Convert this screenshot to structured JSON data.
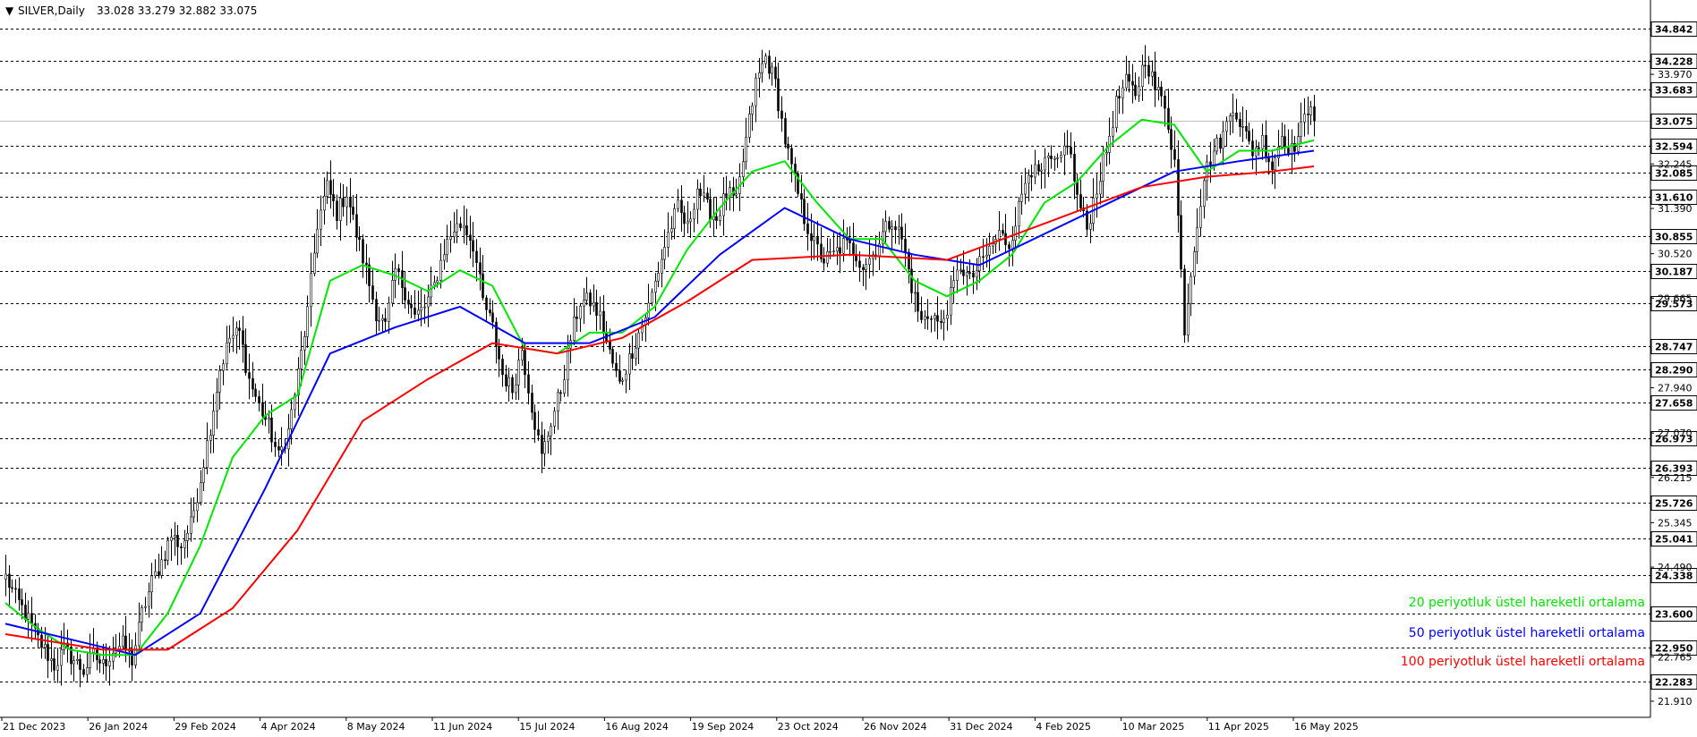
{
  "header": {
    "symbol_label": "SILVER,Daily",
    "ohlc_label": "33.028 33.279 32.882 33.075"
  },
  "legend": [
    {
      "label": "20 periyotluk üstel hareketli ortalama",
      "color": "#00e600"
    },
    {
      "label": "50 periyotluk üstel hareketli ortalama",
      "color": "#0000ff"
    },
    {
      "label": "100 periyotluk üstel hareketli ortalama",
      "color": "#ff0000"
    }
  ],
  "chart_data": {
    "type": "candlestick",
    "x_labels": [
      "21 Dec 2023",
      "26 Jan 2024",
      "29 Feb 2024",
      "4 Apr 2024",
      "8 May 2024",
      "11 Jun 2024",
      "15 Jul 2024",
      "16 Aug 2024",
      "19 Sep 2024",
      "23 Oct 2024",
      "26 Nov 2024",
      "31 Dec 2024",
      "4 Feb 2025",
      "10 Mar 2025",
      "11 Apr 2025",
      "16 May 2025"
    ],
    "ylim": [
      21.6,
      35.4
    ],
    "level_lines": [
      34.842,
      34.228,
      33.683,
      32.594,
      32.085,
      31.61,
      30.855,
      30.187,
      29.573,
      28.747,
      28.29,
      27.658,
      26.973,
      26.393,
      25.726,
      25.041,
      24.338,
      23.6,
      22.95,
      22.283
    ],
    "current_price": 33.075,
    "y_scale_ticks": [
      33.97,
      32.245,
      31.39,
      30.52,
      29.665,
      27.94,
      27.07,
      26.215,
      25.345,
      24.49,
      22.765,
      21.91
    ],
    "price_path": [
      [
        0,
        24.3
      ],
      [
        3,
        23.9
      ],
      [
        6,
        23.6
      ],
      [
        9,
        23.2
      ],
      [
        12,
        22.9
      ],
      [
        15,
        22.6
      ],
      [
        18,
        22.9
      ],
      [
        21,
        22.7
      ],
      [
        24,
        22.5
      ],
      [
        27,
        22.8
      ],
      [
        30,
        22.6
      ],
      [
        33,
        22.9
      ],
      [
        36,
        23.0
      ],
      [
        39,
        22.7
      ],
      [
        42,
        23.6
      ],
      [
        45,
        24.2
      ],
      [
        48,
        24.6
      ],
      [
        51,
        25.1
      ],
      [
        54,
        24.9
      ],
      [
        57,
        25.3
      ],
      [
        60,
        26.2
      ],
      [
        63,
        27.2
      ],
      [
        66,
        28.3
      ],
      [
        69,
        28.9
      ],
      [
        72,
        29.0
      ],
      [
        75,
        28.1
      ],
      [
        78,
        27.6
      ],
      [
        81,
        27.2
      ],
      [
        84,
        26.6
      ],
      [
        87,
        27.1
      ],
      [
        90,
        28.2
      ],
      [
        93,
        29.4
      ],
      [
        96,
        31.1
      ],
      [
        99,
        31.8
      ],
      [
        102,
        31.3
      ],
      [
        105,
        31.7
      ],
      [
        108,
        30.9
      ],
      [
        111,
        30.2
      ],
      [
        114,
        29.4
      ],
      [
        117,
        29.1
      ],
      [
        120,
        30.2
      ],
      [
        123,
        29.8
      ],
      [
        126,
        29.3
      ],
      [
        129,
        29.5
      ],
      [
        132,
        29.9
      ],
      [
        135,
        30.6
      ],
      [
        138,
        31.0
      ],
      [
        141,
        31.1
      ],
      [
        144,
        30.7
      ],
      [
        147,
        29.6
      ],
      [
        150,
        29.1
      ],
      [
        153,
        28.2
      ],
      [
        156,
        27.9
      ],
      [
        159,
        28.7
      ],
      [
        162,
        27.6
      ],
      [
        165,
        26.6
      ],
      [
        168,
        27.3
      ],
      [
        171,
        27.9
      ],
      [
        174,
        28.9
      ],
      [
        177,
        29.6
      ],
      [
        180,
        29.6
      ],
      [
        183,
        29.3
      ],
      [
        186,
        28.6
      ],
      [
        189,
        28.0
      ],
      [
        192,
        28.5
      ],
      [
        195,
        29.0
      ],
      [
        198,
        29.5
      ],
      [
        201,
        30.2
      ],
      [
        204,
        30.9
      ],
      [
        207,
        31.4
      ],
      [
        210,
        31.0
      ],
      [
        213,
        31.8
      ],
      [
        216,
        31.4
      ],
      [
        219,
        31.2
      ],
      [
        222,
        31.7
      ],
      [
        225,
        31.5
      ],
      [
        228,
        32.7
      ],
      [
        231,
        33.8
      ],
      [
        234,
        34.3
      ],
      [
        237,
        33.8
      ],
      [
        240,
        32.7
      ],
      [
        243,
        31.9
      ],
      [
        246,
        31.2
      ],
      [
        249,
        30.7
      ],
      [
        252,
        30.4
      ],
      [
        255,
        30.5
      ],
      [
        258,
        30.7
      ],
      [
        261,
        30.6
      ],
      [
        264,
        30.3
      ],
      [
        267,
        30.5
      ],
      [
        270,
        30.9
      ],
      [
        273,
        31.2
      ],
      [
        276,
        30.8
      ],
      [
        279,
        29.9
      ],
      [
        282,
        29.2
      ],
      [
        285,
        29.4
      ],
      [
        288,
        29.1
      ],
      [
        291,
        29.7
      ],
      [
        294,
        30.3
      ],
      [
        297,
        30.0
      ],
      [
        300,
        30.3
      ],
      [
        303,
        30.6
      ],
      [
        306,
        30.9
      ],
      [
        309,
        30.7
      ],
      [
        312,
        31.4
      ],
      [
        315,
        32.2
      ],
      [
        318,
        32.0
      ],
      [
        321,
        32.3
      ],
      [
        324,
        32.2
      ],
      [
        327,
        32.7
      ],
      [
        330,
        31.6
      ],
      [
        333,
        31.0
      ],
      [
        336,
        31.8
      ],
      [
        339,
        32.5
      ],
      [
        342,
        33.4
      ],
      [
        345,
        33.8
      ],
      [
        348,
        33.6
      ],
      [
        351,
        34.3
      ],
      [
        354,
        33.7
      ],
      [
        357,
        33.4
      ],
      [
        360,
        32.3
      ],
      [
        363,
        29.1
      ],
      [
        366,
        30.7
      ],
      [
        369,
        32.0
      ],
      [
        372,
        32.5
      ],
      [
        375,
        32.8
      ],
      [
        378,
        33.4
      ],
      [
        381,
        32.9
      ],
      [
        384,
        32.5
      ],
      [
        387,
        32.7
      ],
      [
        390,
        32.2
      ],
      [
        393,
        32.8
      ],
      [
        396,
        32.5
      ],
      [
        399,
        32.9
      ],
      [
        402,
        33.5
      ],
      [
        403,
        33.1
      ]
    ],
    "series": [
      {
        "name": "20 periyotluk üstel hareketli ortalama",
        "color": "#00e600",
        "points": [
          [
            0,
            23.8
          ],
          [
            10,
            23.3
          ],
          [
            20,
            22.9
          ],
          [
            30,
            22.8
          ],
          [
            40,
            22.8
          ],
          [
            50,
            23.6
          ],
          [
            60,
            24.9
          ],
          [
            70,
            26.6
          ],
          [
            80,
            27.4
          ],
          [
            90,
            27.8
          ],
          [
            100,
            30.0
          ],
          [
            110,
            30.3
          ],
          [
            120,
            30.1
          ],
          [
            130,
            29.8
          ],
          [
            140,
            30.2
          ],
          [
            150,
            29.9
          ],
          [
            160,
            28.7
          ],
          [
            170,
            28.6
          ],
          [
            180,
            29.0
          ],
          [
            190,
            29.0
          ],
          [
            200,
            29.5
          ],
          [
            210,
            30.6
          ],
          [
            220,
            31.4
          ],
          [
            230,
            32.1
          ],
          [
            240,
            32.3
          ],
          [
            250,
            31.5
          ],
          [
            260,
            30.8
          ],
          [
            270,
            30.8
          ],
          [
            280,
            30.0
          ],
          [
            290,
            29.7
          ],
          [
            300,
            30.0
          ],
          [
            310,
            30.5
          ],
          [
            320,
            31.5
          ],
          [
            330,
            31.9
          ],
          [
            340,
            32.6
          ],
          [
            350,
            33.1
          ],
          [
            360,
            33.0
          ],
          [
            370,
            32.1
          ],
          [
            380,
            32.5
          ],
          [
            390,
            32.5
          ],
          [
            403,
            32.7
          ]
        ]
      },
      {
        "name": "50 periyotluk üstel hareketli ortalama",
        "color": "#0000ff",
        "points": [
          [
            0,
            23.4
          ],
          [
            20,
            23.1
          ],
          [
            40,
            22.8
          ],
          [
            60,
            23.6
          ],
          [
            80,
            26.0
          ],
          [
            100,
            28.6
          ],
          [
            120,
            29.1
          ],
          [
            140,
            29.5
          ],
          [
            160,
            28.8
          ],
          [
            180,
            28.8
          ],
          [
            200,
            29.3
          ],
          [
            220,
            30.5
          ],
          [
            240,
            31.4
          ],
          [
            260,
            30.8
          ],
          [
            280,
            30.5
          ],
          [
            300,
            30.3
          ],
          [
            320,
            30.9
          ],
          [
            340,
            31.5
          ],
          [
            360,
            32.1
          ],
          [
            380,
            32.3
          ],
          [
            403,
            32.5
          ]
        ]
      },
      {
        "name": "100 periyotluk üstel hareketli ortalama",
        "color": "#ff0000",
        "points": [
          [
            0,
            23.2
          ],
          [
            30,
            22.9
          ],
          [
            50,
            22.9
          ],
          [
            70,
            23.7
          ],
          [
            90,
            25.2
          ],
          [
            110,
            27.3
          ],
          [
            130,
            28.1
          ],
          [
            150,
            28.8
          ],
          [
            170,
            28.6
          ],
          [
            190,
            28.9
          ],
          [
            210,
            29.6
          ],
          [
            230,
            30.4
          ],
          [
            260,
            30.5
          ],
          [
            290,
            30.4
          ],
          [
            320,
            31.1
          ],
          [
            350,
            31.8
          ],
          [
            370,
            32.0
          ],
          [
            390,
            32.1
          ],
          [
            403,
            32.2
          ]
        ]
      }
    ]
  }
}
